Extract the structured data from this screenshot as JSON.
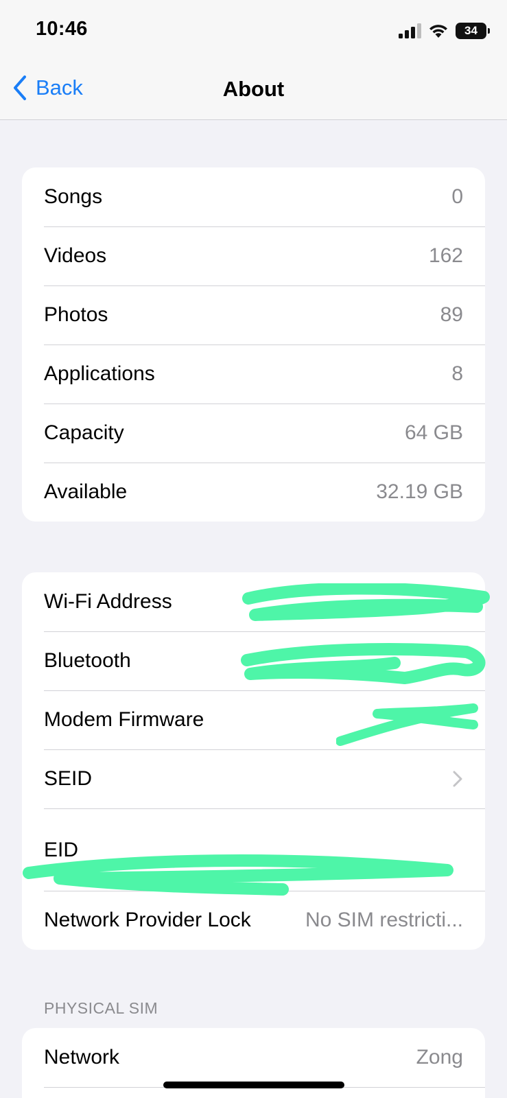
{
  "status_bar": {
    "time": "10:46",
    "battery": "34"
  },
  "nav": {
    "back_label": "Back",
    "title": "About"
  },
  "media_section": [
    {
      "label": "Songs",
      "value": "0"
    },
    {
      "label": "Videos",
      "value": "162"
    },
    {
      "label": "Photos",
      "value": "89"
    },
    {
      "label": "Applications",
      "value": "8"
    },
    {
      "label": "Capacity",
      "value": "64 GB"
    },
    {
      "label": "Available",
      "value": "32.19 GB"
    }
  ],
  "device_section": {
    "wifi_label": "Wi-Fi Address",
    "bluetooth_label": "Bluetooth",
    "modem_label": "Modem Firmware",
    "seid_label": "SEID",
    "eid_label": "EID",
    "lock_label": "Network Provider Lock",
    "lock_value": "No SIM restricti..."
  },
  "sim_section": {
    "header": "PHYSICAL SIM",
    "network_label": "Network",
    "network_value": "Zong"
  },
  "colors": {
    "accent": "#1a7ef7",
    "redaction": "#4ef5a8",
    "background": "#f2f2f7"
  }
}
